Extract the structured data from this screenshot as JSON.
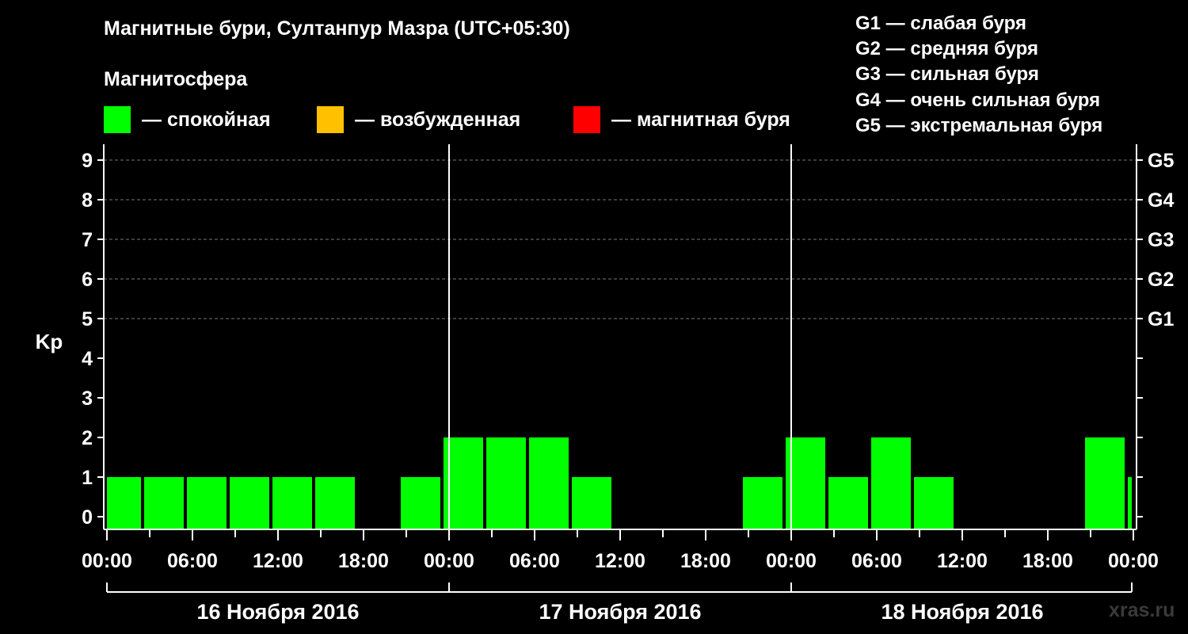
{
  "title": "Магнитные бури, Султанпур Мазра (UTC+05:30)",
  "subtitle": "Магнитосфера",
  "legend": [
    {
      "label": "— спокойная",
      "color": "#00ff00"
    },
    {
      "label": "— возбужденная",
      "color": "#ffc000"
    },
    {
      "label": "— магнитная буря",
      "color": "#ff0000"
    }
  ],
  "storm_levels": [
    "G1 — слабая буря",
    "G2 — средняя буря",
    "G3 — сильная буря",
    "G4 — очень сильная буря",
    "G5 — экстремальная буря"
  ],
  "watermark": "xras.ru",
  "chart_data": {
    "type": "bar",
    "ylabel": "Kp",
    "ylim": [
      0,
      9
    ],
    "y_ticks": [
      "0",
      "1",
      "2",
      "3",
      "4",
      "5",
      "6",
      "7",
      "8",
      "9"
    ],
    "right_ticks": [
      {
        "kp": 5,
        "label": "G1"
      },
      {
        "kp": 6,
        "label": "G2"
      },
      {
        "kp": 7,
        "label": "G3"
      },
      {
        "kp": 8,
        "label": "G4"
      },
      {
        "kp": 9,
        "label": "G5"
      }
    ],
    "x_ticks": [
      "00:00",
      "06:00",
      "12:00",
      "18:00",
      "00:00",
      "06:00",
      "12:00",
      "18:00",
      "00:00",
      "06:00",
      "12:00",
      "18:00",
      "00:00"
    ],
    "days": [
      "16 Ноября 2016",
      "17 Ноября 2016",
      "18 Ноября 2016"
    ],
    "interval_hours": 3,
    "start_hour": -0.5,
    "grid": "dashed horizontal",
    "bar_color": "#00ff00",
    "values": [
      1,
      1,
      1,
      1,
      1,
      1,
      0,
      1,
      2,
      2,
      2,
      1,
      0,
      0,
      0,
      1,
      2,
      1,
      2,
      1,
      0,
      0,
      0,
      2,
      1
    ]
  }
}
